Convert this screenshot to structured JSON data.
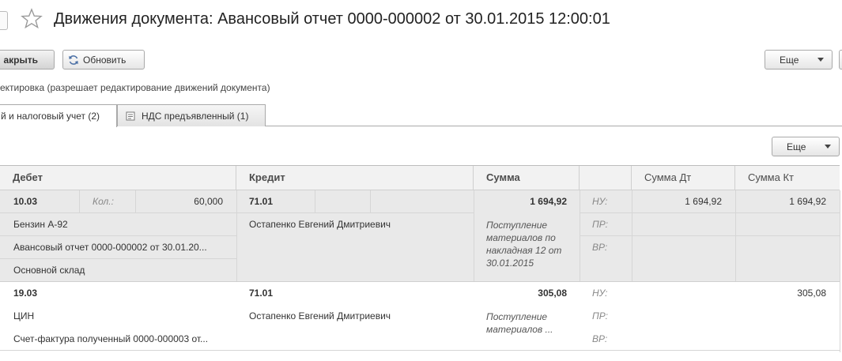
{
  "window": {
    "title": "Движения документа: Авансовый отчет 0000-000002 от 30.01.2015 12:00:01"
  },
  "toolbar": {
    "close_label": "акрыть",
    "refresh_label": "Обновить",
    "more_label": "Еще"
  },
  "edit_hint": "ектировка (разрешает редактирование движений документа)",
  "tabs": [
    {
      "label": "й и налоговый учет (2)",
      "active": true
    },
    {
      "label": "НДС предъявленный (1)",
      "active": false
    }
  ],
  "table": {
    "more_label": "Еще",
    "headers": {
      "debit": "Дебет",
      "credit": "Кредит",
      "sum": "Сумма",
      "sum_dt": "Сумма Дт",
      "sum_kt": "Сумма Кт"
    },
    "rows": [
      {
        "debit_account": "10.03",
        "qty_label": "Кол.:",
        "qty_value": "60,000",
        "credit_account": "71.01",
        "sum": "1 694,92",
        "nu_label": "НУ:",
        "pr_label": "ПР:",
        "vr_label": "ВР:",
        "sum_dt": "1 694,92",
        "sum_kt": "1 694,92",
        "debit_sub1": "Бензин А-92",
        "debit_sub2": "Авансовый отчет 0000-000002 от 30.01.20...",
        "debit_sub3": "Основной склад",
        "credit_sub1": "Остапенко Евгений Дмитриевич",
        "content": "Поступление материалов по накладная 12 от 30.01.2015"
      },
      {
        "debit_account": "19.03",
        "credit_account": "71.01",
        "sum": "305,08",
        "nu_label": "НУ:",
        "pr_label": "ПР:",
        "vr_label": "ВР:",
        "sum_kt": "305,08",
        "debit_sub1": "ЦИН",
        "debit_sub2": "Счет-фактура полученный 0000-000003 от...",
        "credit_sub1": "Остапенко Евгений Дмитриевич",
        "content": "Поступление материалов ..."
      }
    ]
  }
}
